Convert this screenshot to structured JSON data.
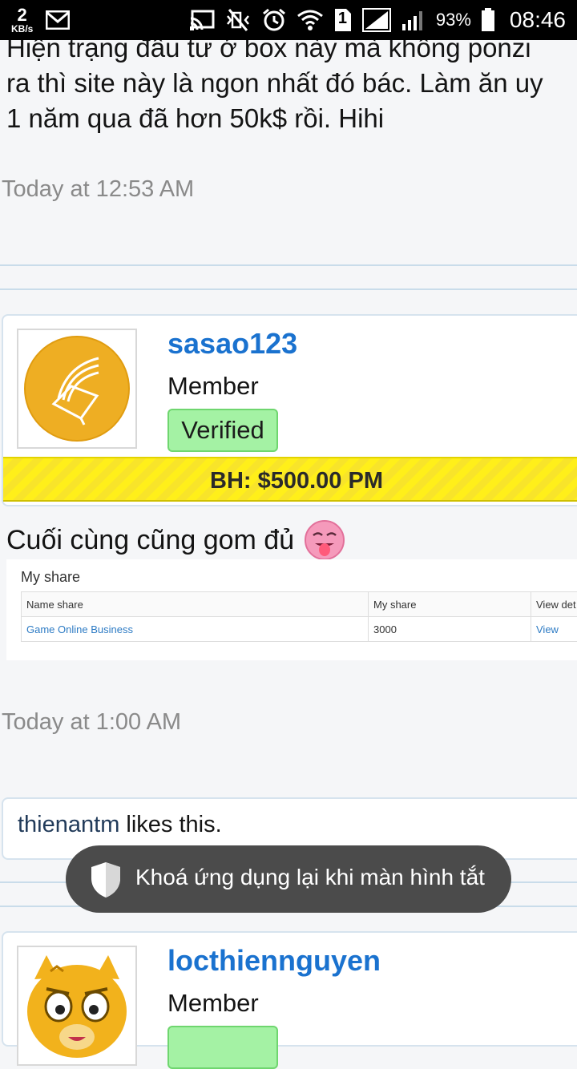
{
  "status_bar": {
    "net_speed_value": "2",
    "net_speed_unit": "KB/s",
    "battery_percent": "93%",
    "time": "08:46",
    "sim_slot": "1",
    "icons": [
      "cast-icon",
      "vibrate-icon",
      "alarm-icon",
      "wifi-icon",
      "sim-icon",
      "signal-icon",
      "battery-icon",
      "gmail-icon"
    ]
  },
  "thread": {
    "prev_post": {
      "text": "Hiện trạng đầu tư ở box này mà không ponzi\nra thì site này là ngon nhất đó bác. Làm ăn uy\n1 năm qua đã hơn 50k$ rồi. Hihi",
      "timestamp": "Today at 12:53 AM"
    },
    "post": {
      "username": "sasao123",
      "role": "Member",
      "badge": "Verified",
      "banner": "BH: $500.00 PM",
      "message": "Cuối cùng cũng gom đủ",
      "screenshot": {
        "title": "My share",
        "columns": [
          "Name share",
          "My share",
          "View det"
        ],
        "rows": [
          [
            "Game Online Business",
            "3000",
            "View"
          ]
        ]
      },
      "timestamp": "Today at 1:00 AM",
      "likes": {
        "user": "thienantm",
        "suffix": " likes this."
      }
    },
    "next_post": {
      "username": "locthiennguyen",
      "role": "Member"
    }
  },
  "toast": {
    "text": "Khoá ứng dụng lại khi màn hình tắt"
  },
  "colors": {
    "accent_blue": "#1a72cf",
    "verified_green": "#a4f2a4",
    "banner_yellow": "#ffef1a",
    "toast_bg": "#4b4b4b"
  }
}
